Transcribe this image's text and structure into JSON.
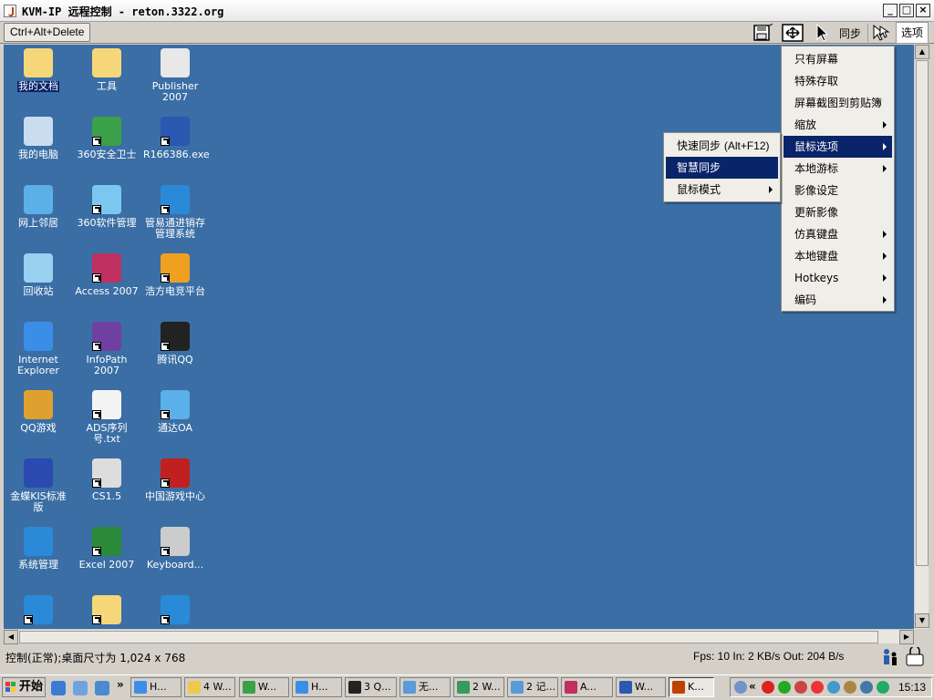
{
  "window": {
    "title": "KVM-IP 远程控制 - reton.3322.org"
  },
  "toolbar": {
    "cad_label": "Ctrl+Alt+Delete",
    "sync_label": "同步",
    "options_label": "选项"
  },
  "desktop_icons": [
    {
      "label": "我的文档",
      "icon": "my-documents-icon"
    },
    {
      "label": "工具",
      "icon": "folder-icon"
    },
    {
      "label": "Publisher 2007",
      "icon": "publisher-icon"
    },
    {
      "label": "我的电脑",
      "icon": "my-computer-icon"
    },
    {
      "label": "360安全卫士",
      "icon": "security-360-icon"
    },
    {
      "label": "R166386.exe",
      "icon": "exe-icon"
    },
    {
      "label": "网上邻居",
      "icon": "network-places-icon"
    },
    {
      "label": "360软件管理",
      "icon": "software-manager-icon"
    },
    {
      "label": "管易通进销存管理系统",
      "icon": "erp-app-icon"
    },
    {
      "label": "回收站",
      "icon": "recycle-bin-icon"
    },
    {
      "label": "Access 2007",
      "icon": "access-icon"
    },
    {
      "label": "浩方电竞平台",
      "icon": "game-platform-icon"
    },
    {
      "label": "Internet Explorer",
      "icon": "internet-explorer-icon"
    },
    {
      "label": "InfoPath 2007",
      "icon": "infopath-icon"
    },
    {
      "label": "腾讯QQ",
      "icon": "qq-icon"
    },
    {
      "label": "QQ游戏",
      "icon": "qq-game-icon"
    },
    {
      "label": "ADS序列号.txt",
      "icon": "text-file-icon"
    },
    {
      "label": "通达OA",
      "icon": "oa-icon"
    },
    {
      "label": "金蝶KIS标准版",
      "icon": "kis-icon"
    },
    {
      "label": "CS1.5",
      "icon": "cs-icon"
    },
    {
      "label": "中国游戏中心",
      "icon": "game-center-icon"
    },
    {
      "label": "系统管理",
      "icon": "system-admin-icon"
    },
    {
      "label": "Excel 2007",
      "icon": "excel-icon"
    },
    {
      "label": "Keyboard...",
      "icon": "keyboard-icon"
    },
    {
      "label": "",
      "icon": "app-icon"
    },
    {
      "label": "",
      "icon": "mail-icon"
    },
    {
      "label": "",
      "icon": "erp-app-icon"
    }
  ],
  "options_menu": [
    {
      "label": "只有屏幕",
      "has_submenu": false
    },
    {
      "label": "特殊存取",
      "has_submenu": false
    },
    {
      "label": "屏幕截图到剪贴簿",
      "has_submenu": false
    },
    {
      "label": "缩放",
      "has_submenu": true
    },
    {
      "label": "鼠标选项",
      "has_submenu": true
    },
    {
      "label": "本地游标",
      "has_submenu": true
    },
    {
      "label": "影像设定",
      "has_submenu": false
    },
    {
      "label": "更新影像",
      "has_submenu": false
    },
    {
      "label": "仿真键盘",
      "has_submenu": true
    },
    {
      "label": "本地键盘",
      "has_submenu": true
    },
    {
      "label": "Hotkeys",
      "has_submenu": true
    },
    {
      "label": "编码",
      "has_submenu": true
    }
  ],
  "mouse_submenu": [
    {
      "label": "快速同步",
      "accel": "(Alt+F12)",
      "has_submenu": false
    },
    {
      "label": "智慧同步",
      "accel": "",
      "has_submenu": false
    },
    {
      "label": "鼠标模式",
      "accel": "",
      "has_submenu": true
    }
  ],
  "status": {
    "left": "控制(正常);桌面尺寸为 1,024 x 768",
    "right": "Fps: 10 In: 2 KB/s Out: 204 B/s"
  },
  "taskbar": {
    "start_label": "开始",
    "overflow": "»",
    "tasks": [
      {
        "label": "H...",
        "icon": "ie-icon"
      },
      {
        "label": "4 W...",
        "icon": "folder-icon"
      },
      {
        "label": "W...",
        "icon": "app-icon"
      },
      {
        "label": "H...",
        "icon": "ie-icon"
      },
      {
        "label": "3 Q...",
        "icon": "qq-icon"
      },
      {
        "label": "无...",
        "icon": "notepad-icon"
      },
      {
        "label": "2 W...",
        "icon": "users-icon"
      },
      {
        "label": "2 记...",
        "icon": "notepad-icon"
      },
      {
        "label": "A...",
        "icon": "access-icon"
      },
      {
        "label": "W...",
        "icon": "word-icon"
      },
      {
        "label": "K...",
        "icon": "java-icon"
      }
    ],
    "tray_expand": "«",
    "clock": "15:13"
  }
}
